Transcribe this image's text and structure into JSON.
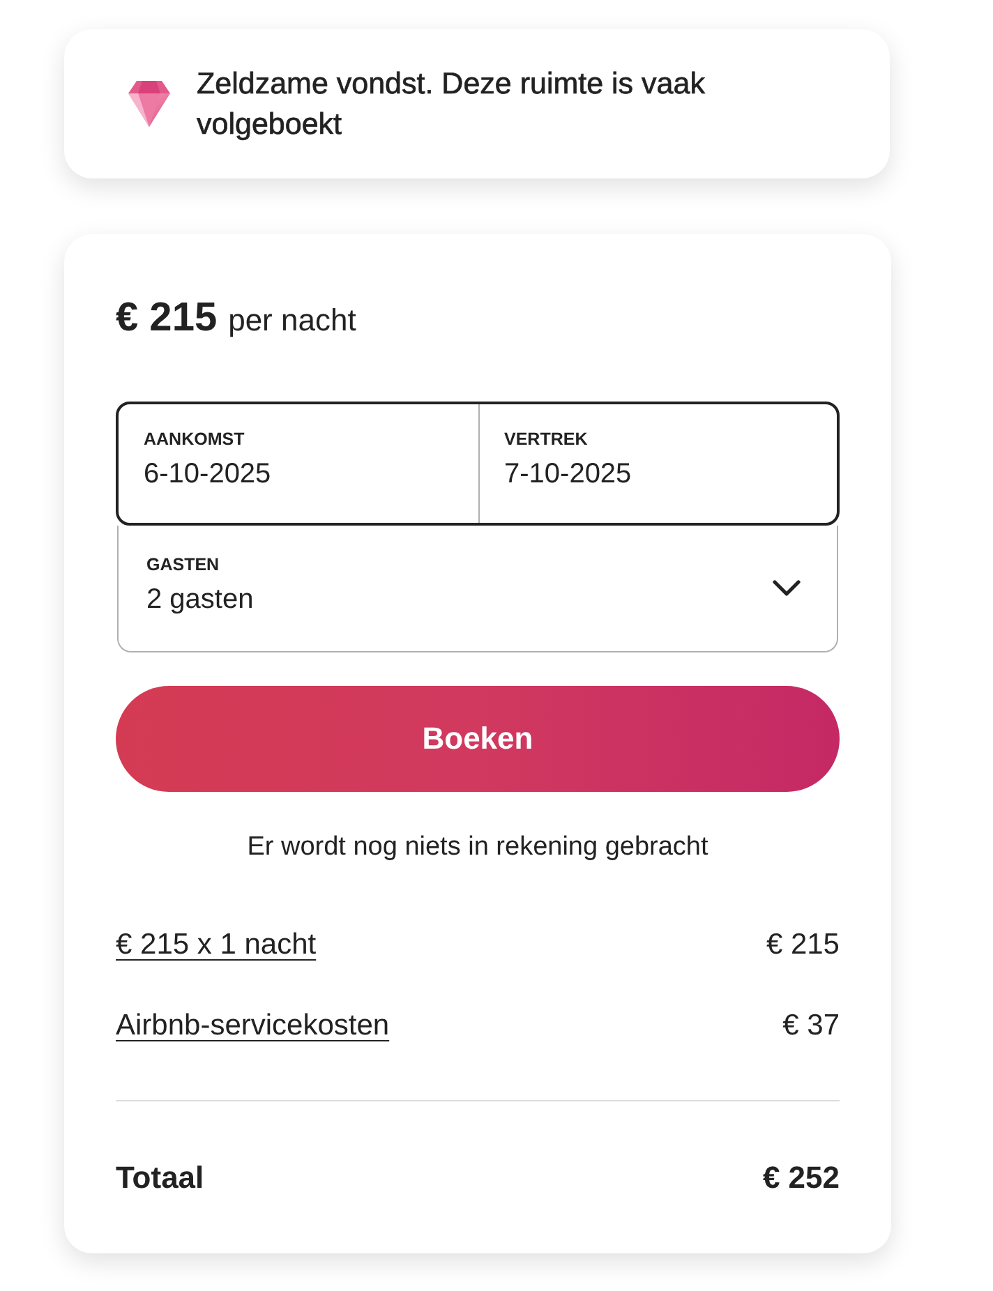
{
  "notice": {
    "text": "Zeldzame vondst. Deze ruimte is vaak volgeboekt"
  },
  "booking": {
    "price": "€ 215",
    "price_unit": "per nacht",
    "date_range": {
      "focused": true,
      "fields": [
        {
          "label": "AANKOMST",
          "value": "6-10-2025"
        },
        {
          "label": "VERTREK",
          "value": "7-10-2025"
        }
      ]
    },
    "guests": {
      "label": "GASTEN",
      "value": "2 gasten"
    },
    "book_button": "Boeken",
    "note": "Er wordt nog niets in rekening gebracht",
    "line_items": [
      {
        "label": "€ 215 x 1 nacht",
        "amount": "€ 215"
      },
      {
        "label": "Airbnb-servicekosten",
        "amount": "€ 37"
      }
    ],
    "total": {
      "label": "Totaal",
      "amount": "€ 252"
    }
  }
}
